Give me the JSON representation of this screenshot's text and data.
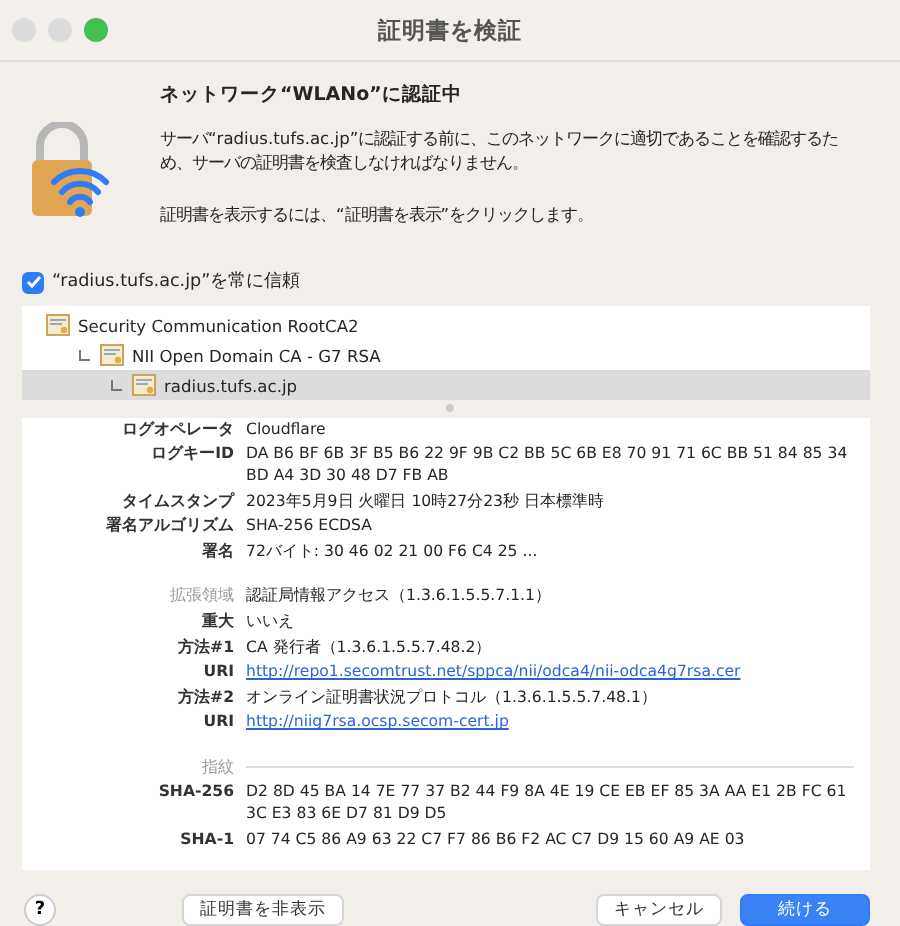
{
  "window": {
    "title": "証明書を検証"
  },
  "header": {
    "title": "ネットワーク“WLANo”に認証中",
    "message": "サーバ“radius.tufs.ac.jp”に認証する前に、このネットワークに適切であることを確認するため、サーバの証明書を検査しなければなりません。",
    "hint": "証明書を表示するには、“証明書を表示”をクリックします。"
  },
  "trust": {
    "label": "“radius.tufs.ac.jp”を常に信頼",
    "checked": true
  },
  "chain": [
    {
      "name": "Security Communication RootCA2",
      "selected": false,
      "children": [
        {
          "name": "NII Open Domain CA - G7 RSA",
          "selected": false,
          "children": [
            {
              "name": "radius.tufs.ac.jp",
              "selected": true
            }
          ]
        }
      ]
    }
  ],
  "details": [
    {
      "kind": "field",
      "label": "ログオペレータ",
      "value": "Cloudflare"
    },
    {
      "kind": "field",
      "label": "ログキーID",
      "value": "DA B6 BF 6B 3F B5 B6 22 9F 9B C2 BB 5C 6B E8 70 91 71 6C BB 51 84 85 34 BD A4 3D 30 48 D7 FB AB"
    },
    {
      "kind": "field",
      "label": "タイムスタンプ",
      "value": "2023年5月9日 火曜日 10時27分23秒 日本標準時"
    },
    {
      "kind": "field",
      "label": "署名アルゴリズム",
      "value": "SHA-256 ECDSA"
    },
    {
      "kind": "field",
      "label": "署名",
      "value": "72バイト: 30 46 02 21 00 F6 C4 25 ..."
    },
    {
      "kind": "section",
      "label": "拡張領域",
      "value": "認証局情報アクセス（1.3.6.1.5.5.7.1.1）"
    },
    {
      "kind": "field",
      "label": "重大",
      "value": "いいえ"
    },
    {
      "kind": "field",
      "label": "方法#1",
      "value": "CA 発行者（1.3.6.1.5.5.7.48.2）"
    },
    {
      "kind": "link",
      "label": "URI",
      "value": "http://repo1.secomtrust.net/sppca/nii/odca4/nii-odca4g7rsa.cer"
    },
    {
      "kind": "field",
      "label": "方法#2",
      "value": "オンライン証明書状況プロトコル（1.3.6.1.5.5.7.48.1）"
    },
    {
      "kind": "link",
      "label": "URI",
      "value": "http://niig7rsa.ocsp.secom-cert.jp"
    },
    {
      "kind": "section",
      "label": "指紋"
    },
    {
      "kind": "field",
      "label": "SHA-256",
      "value": "D2 8D 45 BA 14 7E 77 37 B2 44 F9 8A 4E 19 CE EB EF 85 3A AA E1 2B FC 61 3C E3 83 6E D7 81 D9 D5"
    },
    {
      "kind": "field",
      "label": "SHA-1",
      "value": "07 74 C5 86 A9 63 22 C7 F7 86 B6 F2 AC C7 D9 15 60 A9 AE 03"
    }
  ],
  "buttons": {
    "help": "?",
    "toggle": "証明書を非表示",
    "cancel": "キャンセル",
    "continue": "続ける"
  }
}
